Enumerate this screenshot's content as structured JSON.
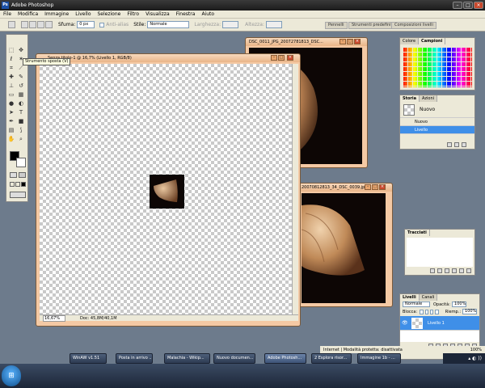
{
  "app": {
    "title": "Adobe Photoshop",
    "logo": "Ps"
  },
  "menu": [
    "File",
    "Modifica",
    "Immagine",
    "Livello",
    "Selezione",
    "Filtro",
    "Visualizza",
    "Finestra",
    "Aiuto"
  ],
  "options": {
    "feather_label": "Sfuma:",
    "feather_value": "0 px",
    "antialias": "Anti-alias",
    "style_label": "Stile:",
    "style_value": "Normale",
    "width_label": "Larghezza:",
    "height_label": "Altezza:"
  },
  "wells": [
    "Pennelli",
    "Strumenti predefiniti",
    "Composizioni livelli"
  ],
  "tooltip": "Strumento sposta (V)",
  "doc_main": {
    "title": "Senza titolo-1 @ 16,7% (Livello 1, RGB/8)",
    "zoom": "16,67%",
    "status": "Doc: 45,8M/40,1M"
  },
  "doc_2": {
    "title": "DSC_0011_JPG_20072781813_DSC..."
  },
  "doc_3": {
    "title": "20070812813_34_DSC_0039.jpg"
  },
  "color_panel": {
    "tabs": [
      "Colore",
      "Campioni"
    ]
  },
  "history_panel": {
    "tabs": [
      "Storia",
      "Azioni"
    ],
    "snapshot": "Nuovo",
    "items": [
      "Nuovo",
      "Livello"
    ]
  },
  "navigator_panel": {
    "tabs": [
      "Tracciati"
    ]
  },
  "layers_panel": {
    "tabs": [
      "Livelli",
      "Canali"
    ],
    "blend": "Normale",
    "opacity_label": "Opacità:",
    "opacity_value": "100%",
    "lock_label": "Blocca:",
    "fill_label": "Riemp.:",
    "fill_value": "100%",
    "layer_name": "Livello 1"
  },
  "statusbar": {
    "text": "Internet | Modalità protetta: disattivata",
    "zoom": "100%"
  },
  "taskbar": {
    "items": [
      "WinAW v1.51",
      "Posta in arrivo ...",
      "Malachia - Wikip...",
      "Nuovo documen...",
      "Adobe Photosh...",
      "2 Esplora risor...",
      "Immagine 1b - ..."
    ],
    "tray": "▴ ◐ ))"
  },
  "colors": {
    "accent": "#3f8fe8",
    "doc_frame": "#f4c9a4",
    "chrome": "#ece9d8",
    "desktop": "#6d7b8c"
  }
}
